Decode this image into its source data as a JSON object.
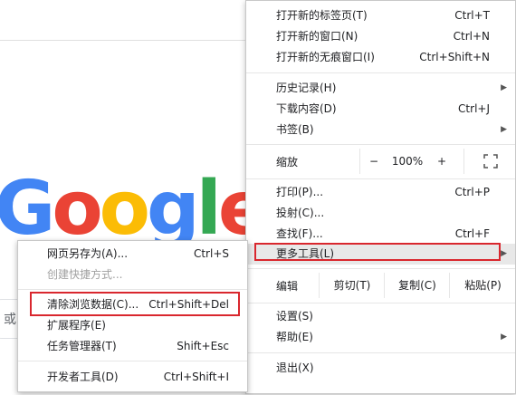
{
  "background": {
    "logo_letters": [
      "G",
      "o",
      "o",
      "g",
      "l",
      "e"
    ],
    "logo_colors": [
      "#4285f4",
      "#ea4335",
      "#fbbc05",
      "#4285f4",
      "#34a853",
      "#ea4335"
    ],
    "search_hint": "或"
  },
  "menu": {
    "new_tab": {
      "label": "打开新的标签页(T)",
      "shortcut": "Ctrl+T"
    },
    "new_window": {
      "label": "打开新的窗口(N)",
      "shortcut": "Ctrl+N"
    },
    "new_incognito": {
      "label": "打开新的无痕窗口(I)",
      "shortcut": "Ctrl+Shift+N"
    },
    "history": {
      "label": "历史记录(H)"
    },
    "downloads": {
      "label": "下载内容(D)",
      "shortcut": "Ctrl+J"
    },
    "bookmarks": {
      "label": "书签(B)"
    },
    "zoom": {
      "label": "缩放",
      "minus": "−",
      "value": "100%",
      "plus": "+"
    },
    "print": {
      "label": "打印(P)...",
      "shortcut": "Ctrl+P"
    },
    "cast": {
      "label": "投射(C)..."
    },
    "find": {
      "label": "查找(F)...",
      "shortcut": "Ctrl+F"
    },
    "more_tools": {
      "label": "更多工具(L)"
    },
    "edit": {
      "label": "编辑",
      "cut": "剪切(T)",
      "copy": "复制(C)",
      "paste": "粘贴(P)"
    },
    "settings": {
      "label": "设置(S)"
    },
    "help": {
      "label": "帮助(E)"
    },
    "exit": {
      "label": "退出(X)"
    }
  },
  "submenu": {
    "save_page": {
      "label": "网页另存为(A)...",
      "shortcut": "Ctrl+S"
    },
    "create_shortcut": {
      "label": "创建快捷方式..."
    },
    "clear_data": {
      "label": "清除浏览数据(C)...",
      "shortcut": "Ctrl+Shift+Del"
    },
    "extensions": {
      "label": "扩展程序(E)"
    },
    "task_manager": {
      "label": "任务管理器(T)",
      "shortcut": "Shift+Esc"
    },
    "dev_tools": {
      "label": "开发者工具(D)",
      "shortcut": "Ctrl+Shift+I"
    }
  },
  "colors": {
    "highlight": "#d9272e"
  }
}
